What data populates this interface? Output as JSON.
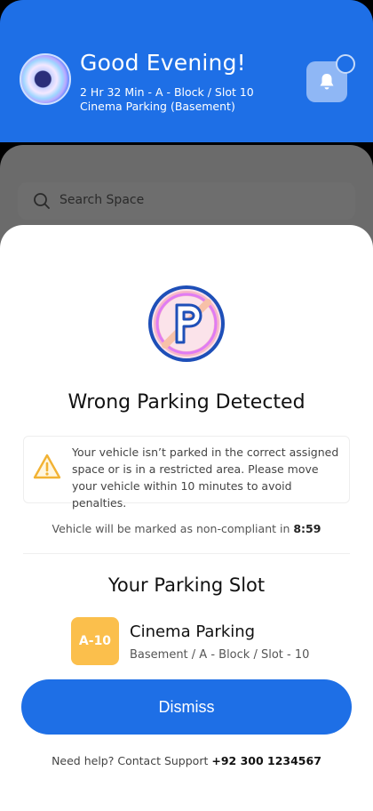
{
  "header": {
    "greeting": "Good Evening!",
    "session_line": "2 Hr 32 Min - A - Block / Slot 10",
    "location_line": "Cinema Parking (Basement)"
  },
  "search": {
    "placeholder": "Search Space"
  },
  "alert": {
    "title": "Wrong Parking Detected",
    "warning_text": "Your vehicle isn’t parked in the correct assigned space or is in a restricted area. Please move your vehicle within 10 minutes to avoid penalties.",
    "countdown_prefix": "Vehicle will be marked as non-compliant in ",
    "countdown_value": "8:59"
  },
  "slot": {
    "section_title": "Your Parking Slot",
    "code": "A-10",
    "name": "Cinema Parking",
    "detail": "Basement / A - Block / Slot - 10"
  },
  "actions": {
    "dismiss_label": "Dismiss"
  },
  "support": {
    "prefix": "Need help? Contact Support ",
    "phone": "+92 300 1234567"
  },
  "colors": {
    "primary": "#1e6fe6",
    "badge": "#fbbf4c",
    "warning": "#f2b233"
  }
}
